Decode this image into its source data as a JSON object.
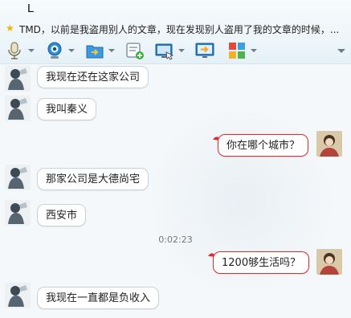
{
  "window": {
    "title": "L",
    "signature": "TMD，以前是我盗用别人的文章，现在发现别人盗用了我的文章的时候，..."
  },
  "toolbar": {
    "items": [
      {
        "name": "voice-call-icon"
      },
      {
        "name": "video-call-icon"
      },
      {
        "name": "send-file-icon"
      },
      {
        "name": "add-text-message-icon"
      },
      {
        "name": "remote-desktop-icon"
      },
      {
        "name": "share-screen-icon"
      },
      {
        "name": "apps-icon"
      }
    ]
  },
  "messages": [
    {
      "side": "left",
      "text": "我现在还在这家公司"
    },
    {
      "side": "left",
      "text": "我叫秦义"
    },
    {
      "side": "right",
      "text": "你在哪个城市？"
    },
    {
      "side": "left",
      "text": "那家公司是大德尚宅"
    },
    {
      "side": "left",
      "text": "西安市"
    },
    {
      "side": "time",
      "text": "0:02:23"
    },
    {
      "side": "right",
      "text": "1200够生活吗？"
    },
    {
      "side": "left",
      "text": "我现在一直都是负收入"
    }
  ],
  "colors": {
    "outgoing_border": "#e12b2b",
    "incoming_border": "#c9d2d8",
    "star": "#f0b400"
  }
}
